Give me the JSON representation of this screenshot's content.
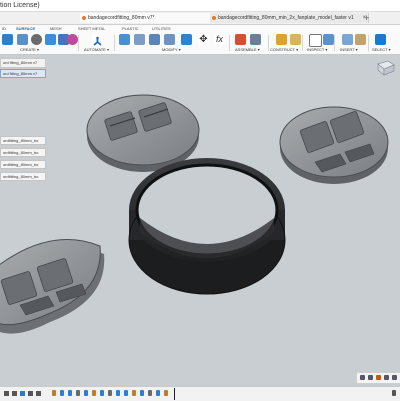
{
  "window": {
    "title": "tion License)"
  },
  "tabs": [
    {
      "label": "bandagecordfitting_80mm v7*",
      "active": true
    },
    {
      "label": "bandagecordfitting_80mm_min_2x_fanplate_model_faster v1",
      "active": false
    }
  ],
  "toolbar_tabs": [
    "ID",
    "SURFACE",
    "MESH",
    "SHEET METAL",
    "PLASTIC",
    "UTILITIES"
  ],
  "toolbar_groups": [
    "CREATE",
    "AUTOMATE",
    "MODIFY",
    "ASSEMBLE",
    "CONSTRUCT",
    "INSPECT",
    "INSERT",
    "SELECT"
  ],
  "browser": {
    "header": "ord ftting_80mm v7",
    "items": [
      "ordfitting_80mm_bo",
      "ordfitting_80mm_bo",
      "ordfitting_80mm_bo",
      "ordfitting_80mm_bo"
    ]
  },
  "colors": {
    "accent": "#0a6ebd",
    "viewport_bg": "#c9ced3",
    "part_light": "#8a8d90",
    "part_dark": "#2b2c2e"
  },
  "icons": {
    "undo": "undo-arrow-icon",
    "cube_view": "viewcube-icon",
    "timeline_play": "play-icon"
  }
}
